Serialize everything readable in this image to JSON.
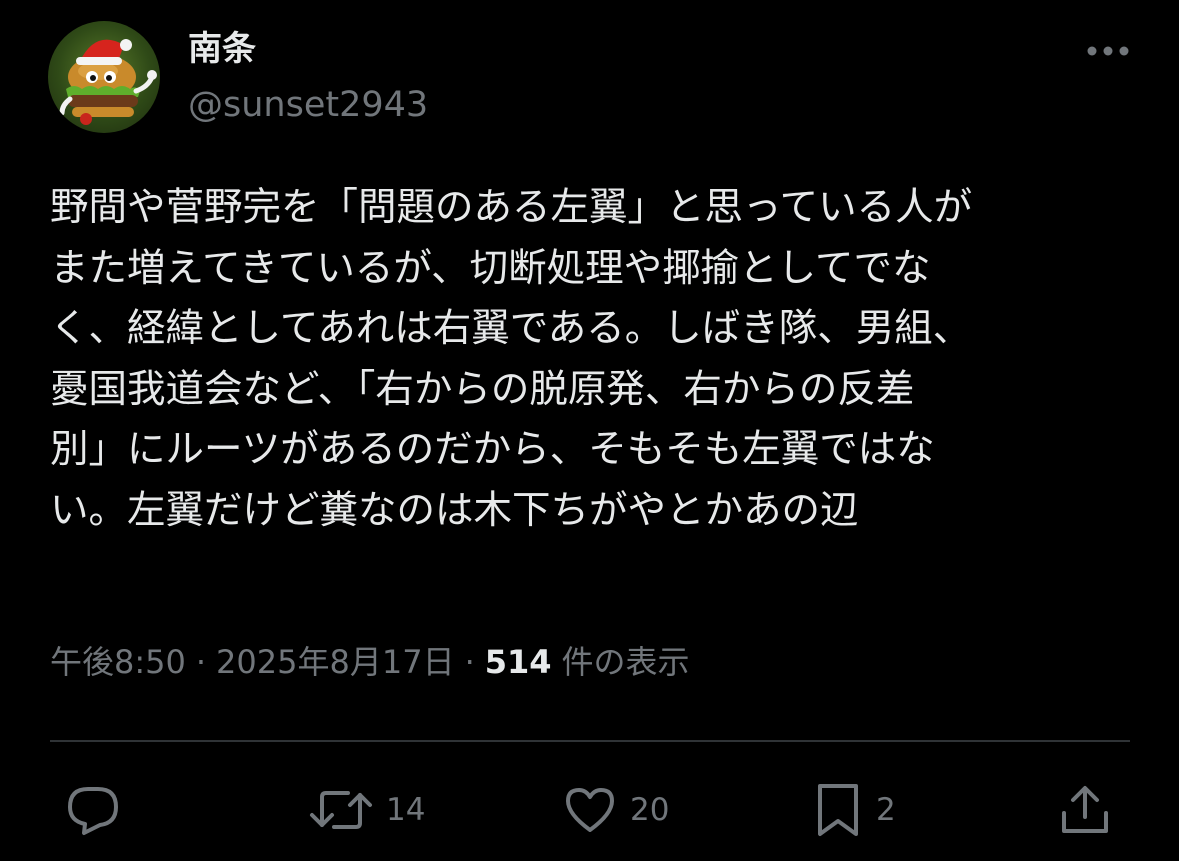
{
  "author": {
    "display_name": "南条",
    "handle": "@sunset2943",
    "avatar": "hamburger-character-avatar"
  },
  "tweet": {
    "text_lines": [
      "野間や菅野完を「問題のある左翼」と思っている人が",
      "また増えてきているが、切断処理や揶揄としてでな",
      "く、経緯としてあれは右翼である。しばき隊、男組、",
      "憂国我道会など、「右からの脱原発、右からの反差",
      "別」にルーツがあるのだから、そもそも左翼ではな",
      "い。左翼だけど糞なのは木下ちがやとかあの辺"
    ],
    "time": "午後8:50",
    "date": "2025年8月17日",
    "separator": "·",
    "views_count": "514",
    "views_label": "件の表示"
  },
  "actions": {
    "reply_count": "",
    "repost_count": "14",
    "like_count": "20",
    "bookmark_count": "2"
  },
  "icons": {
    "more": "more-dots-icon",
    "reply": "reply-bubble-icon",
    "repost": "repost-arrows-icon",
    "like": "heart-icon",
    "bookmark": "bookmark-icon",
    "share": "share-upload-icon"
  },
  "colors": {
    "background": "#000000",
    "primary_text": "#e7e9ea",
    "secondary_text": "#71767b",
    "divider": "#2f3336"
  }
}
